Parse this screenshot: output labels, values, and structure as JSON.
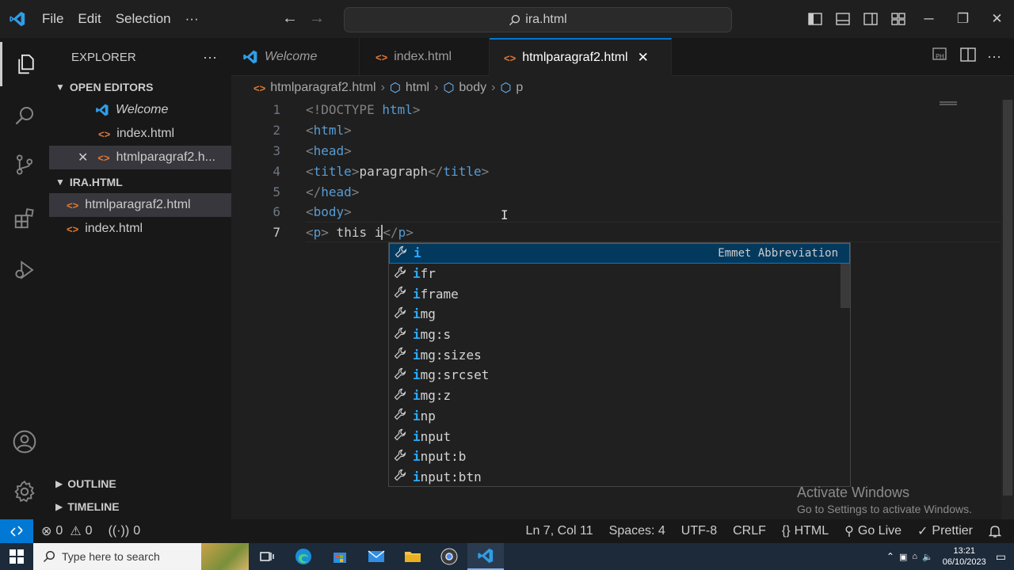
{
  "titlebar": {
    "menu": [
      "File",
      "Edit",
      "Selection",
      "···"
    ],
    "search_text": "ira.html",
    "window_buttons": [
      "─",
      "❐",
      "✕"
    ]
  },
  "explorer": {
    "title": "EXPLORER",
    "more": "···",
    "open_editors_label": "OPEN EDITORS",
    "open_editors": [
      "Welcome",
      "index.html",
      "htmlparagraf2.h..."
    ],
    "folder_label": "IRA.HTML",
    "files": [
      "htmlparagraf2.html",
      "index.html"
    ],
    "outline_label": "OUTLINE",
    "timeline_label": "TIMELINE"
  },
  "tabs": [
    {
      "label": "Welcome"
    },
    {
      "label": "index.html"
    },
    {
      "label": "htmlparagraf2.html"
    }
  ],
  "breadcrumb": [
    "htmlparagraf2.html",
    "html",
    "body",
    "p"
  ],
  "editor": {
    "line_numbers": [
      "1",
      "2",
      "3",
      "4",
      "5",
      "6",
      "7"
    ]
  },
  "suggestions": {
    "items": [
      "i",
      "ifr",
      "iframe",
      "img",
      "img:s",
      "img:sizes",
      "img:srcset",
      "img:z",
      "inp",
      "input",
      "input:b",
      "input:btn"
    ],
    "focused_detail": "Emmet Abbreviation"
  },
  "watermark": {
    "line1": "Activate Windows",
    "line2": "Go to Settings to activate Windows."
  },
  "statusbar": {
    "errors": "0",
    "warnings": "0",
    "ports": "0",
    "position": "Ln 7, Col 11",
    "spaces": "Spaces: 4",
    "encoding": "UTF-8",
    "eol": "CRLF",
    "language": "HTML",
    "golive": "Go Live",
    "prettier": "Prettier"
  },
  "taskbar": {
    "search_placeholder": "Type here to search",
    "time": "13:21",
    "date": "06/10/2023"
  },
  "colors": {
    "accent": "#0078d4",
    "html_icon": "#e37933",
    "tag_name": "#569cd6"
  }
}
